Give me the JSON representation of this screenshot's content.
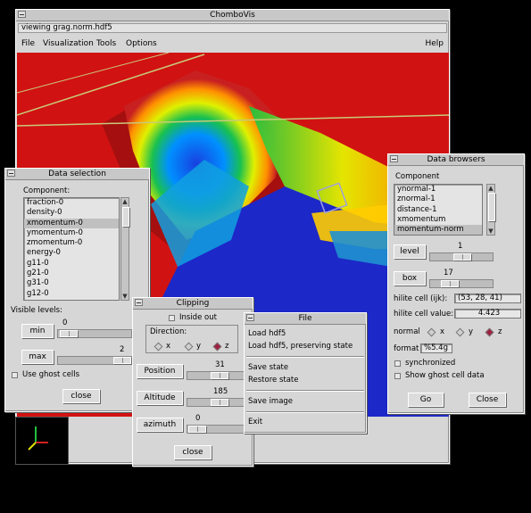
{
  "main": {
    "title": "ChomboVis",
    "status": "viewing grag.norm.hdf5",
    "menu": [
      "File",
      "Visualization",
      "Tools",
      "Options"
    ],
    "help": "Help"
  },
  "data_selection": {
    "title": "Data selection",
    "component_label": "Component:",
    "components": [
      "fraction-0",
      "density-0",
      "xmomentum-0",
      "ymomentum-0",
      "zmomentum-0",
      "energy-0",
      "g11-0",
      "g21-0",
      "g31-0",
      "g12-0"
    ],
    "selected_index": 2,
    "visible_levels_label": "Visible levels:",
    "min_label": "min",
    "min_value": "0",
    "max_label": "max",
    "max_value": "2",
    "ghost_label": "Use ghost cells",
    "close_label": "close"
  },
  "clipping": {
    "title": "Clipping",
    "inside_out": "Inside out",
    "direction_label": "Direction:",
    "axes": [
      "x",
      "y",
      "z"
    ],
    "selected_axis": "z",
    "position_label": "Position",
    "position_value": "31",
    "altitude_label": "Altitude",
    "altitude_value": "185",
    "azimuth_label": "azimuth",
    "azimuth_value": "0",
    "close_label": "close"
  },
  "file_menu": {
    "title": "File",
    "items": [
      "Load hdf5",
      "Load hdf5, preserving state",
      "Save state",
      "Restore state",
      "Save image",
      "Exit"
    ]
  },
  "data_browsers": {
    "title": "Data browsers",
    "component_label": "Component",
    "components": [
      "ynormal-1",
      "znormal-1",
      "distance-1",
      "xmomentum",
      "momentum-norm"
    ],
    "selected_index": 4,
    "level_label": "level",
    "level_value": "1",
    "box_label": "box",
    "box_value": "17",
    "hilite_cell_label": "hilite cell (ijk):",
    "hilite_cell_value": "(53, 28, 41)",
    "hilite_value_label": "hilite cell value:",
    "hilite_value": "4.423",
    "normal_label": "normal",
    "axes": [
      "x",
      "y",
      "z"
    ],
    "selected_axis": "z",
    "format_label": "format",
    "format_value": "%5.4g",
    "synchronized_label": "synchronized",
    "ghost_label": "Show ghost cell data",
    "go_label": "Go",
    "close_label": "Close"
  },
  "colors": {
    "background": "#000000",
    "panel": "#d6d6d6",
    "render_bg": "#d11212",
    "radio_on": "#a02040"
  }
}
